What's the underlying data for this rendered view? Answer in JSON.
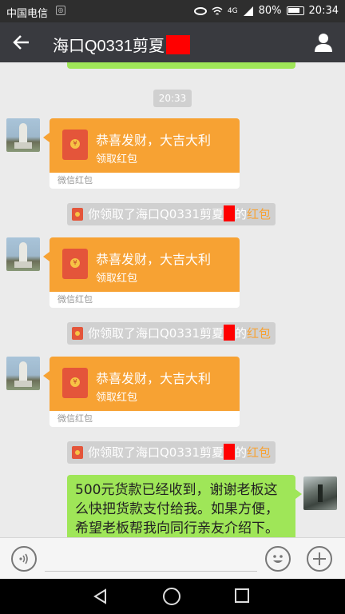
{
  "status_bar": {
    "carrier": "中国电信",
    "sim_badge": "◎",
    "network_label": "4G",
    "battery": "80%",
    "time": "20:34"
  },
  "header": {
    "title": "海口Q0331剪夏"
  },
  "chat": {
    "timestamp": "20:33",
    "red_packets": [
      {
        "greeting": "恭喜发财，大吉大利",
        "claim": "领取红包",
        "footer": "微信红包"
      },
      {
        "greeting": "恭喜发财，大吉大利",
        "claim": "领取红包",
        "footer": "微信红包"
      },
      {
        "greeting": "恭喜发财，大吉大利",
        "claim": "领取红包",
        "footer": "微信红包"
      }
    ],
    "system_messages": [
      {
        "prefix": "你领取了海口Q0331剪夏",
        "middle": "的",
        "link": "红包"
      },
      {
        "prefix": "你领取了海口Q0331剪夏",
        "middle": "的",
        "link": "红包"
      },
      {
        "prefix": "你领取了海口Q0331剪夏",
        "middle": "的",
        "link": "红包"
      }
    ],
    "outgoing_message": "500元货款已经收到，谢谢老板这么快把货款支付给我。如果方便，希望老板帮我向同行亲友介绍下。"
  },
  "colors": {
    "header_bg": "#393a3f",
    "red_packet": "#f7a233",
    "green_bubble": "#9fe658",
    "redaction": "#ff0000"
  },
  "icons": [
    "back-arrow-icon",
    "user-icon",
    "voice-icon",
    "emoji-icon",
    "plus-icon",
    "red-packet-icon"
  ]
}
